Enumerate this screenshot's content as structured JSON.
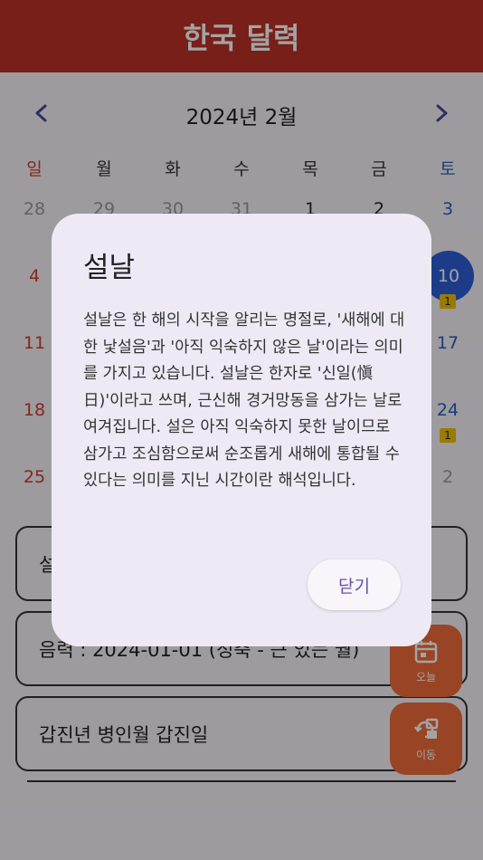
{
  "app": {
    "title": "한국 달력"
  },
  "calendar": {
    "month_label": "2024년 2월",
    "weekdays": [
      "일",
      "월",
      "화",
      "수",
      "목",
      "금",
      "토"
    ],
    "week1": [
      "28",
      "29",
      "30",
      "31",
      "1",
      "2",
      "3"
    ],
    "week2_sun": "4",
    "week2_sat": "10",
    "week3_sun": "11",
    "week3_sat": "17",
    "week4_sun": "18",
    "week4_sat": "24",
    "week5_sun": "25",
    "week5_sat": "2",
    "badge_count": "1"
  },
  "info_cards": {
    "holiday_partial": "설",
    "lunar_partial": "음력 : 2024-01-01 (정축 - 큰 있는 월)",
    "ganji": "갑진년 병인월 갑진일"
  },
  "fabs": {
    "today_label": "오늘",
    "move_label": "이동"
  },
  "dialog": {
    "title": "설날",
    "body": "설날은 한 해의 시작을 알리는 명절로, '새해에 대한 낯설음'과 '아직 익숙하지 않은 날'이라는 의미를 가지고 있습니다. 설날은 한자로 '신일(愼日)'이라고 쓰며, 근신해 경거망동을 삼가는 날로 여겨집니다. 설은 아직 익숙하지 못한 날이므로 삼가고 조심함으로써 순조롭게 새해에 통합될 수 있다는 의미를 지닌 시간이란 해석입니다.",
    "close_label": "닫기"
  },
  "colors": {
    "appbar": "#bb3126",
    "fab": "#f06b3a",
    "today": "#2d5fd8",
    "sunday": "#d23a2f",
    "saturday": "#2a5fbf"
  }
}
